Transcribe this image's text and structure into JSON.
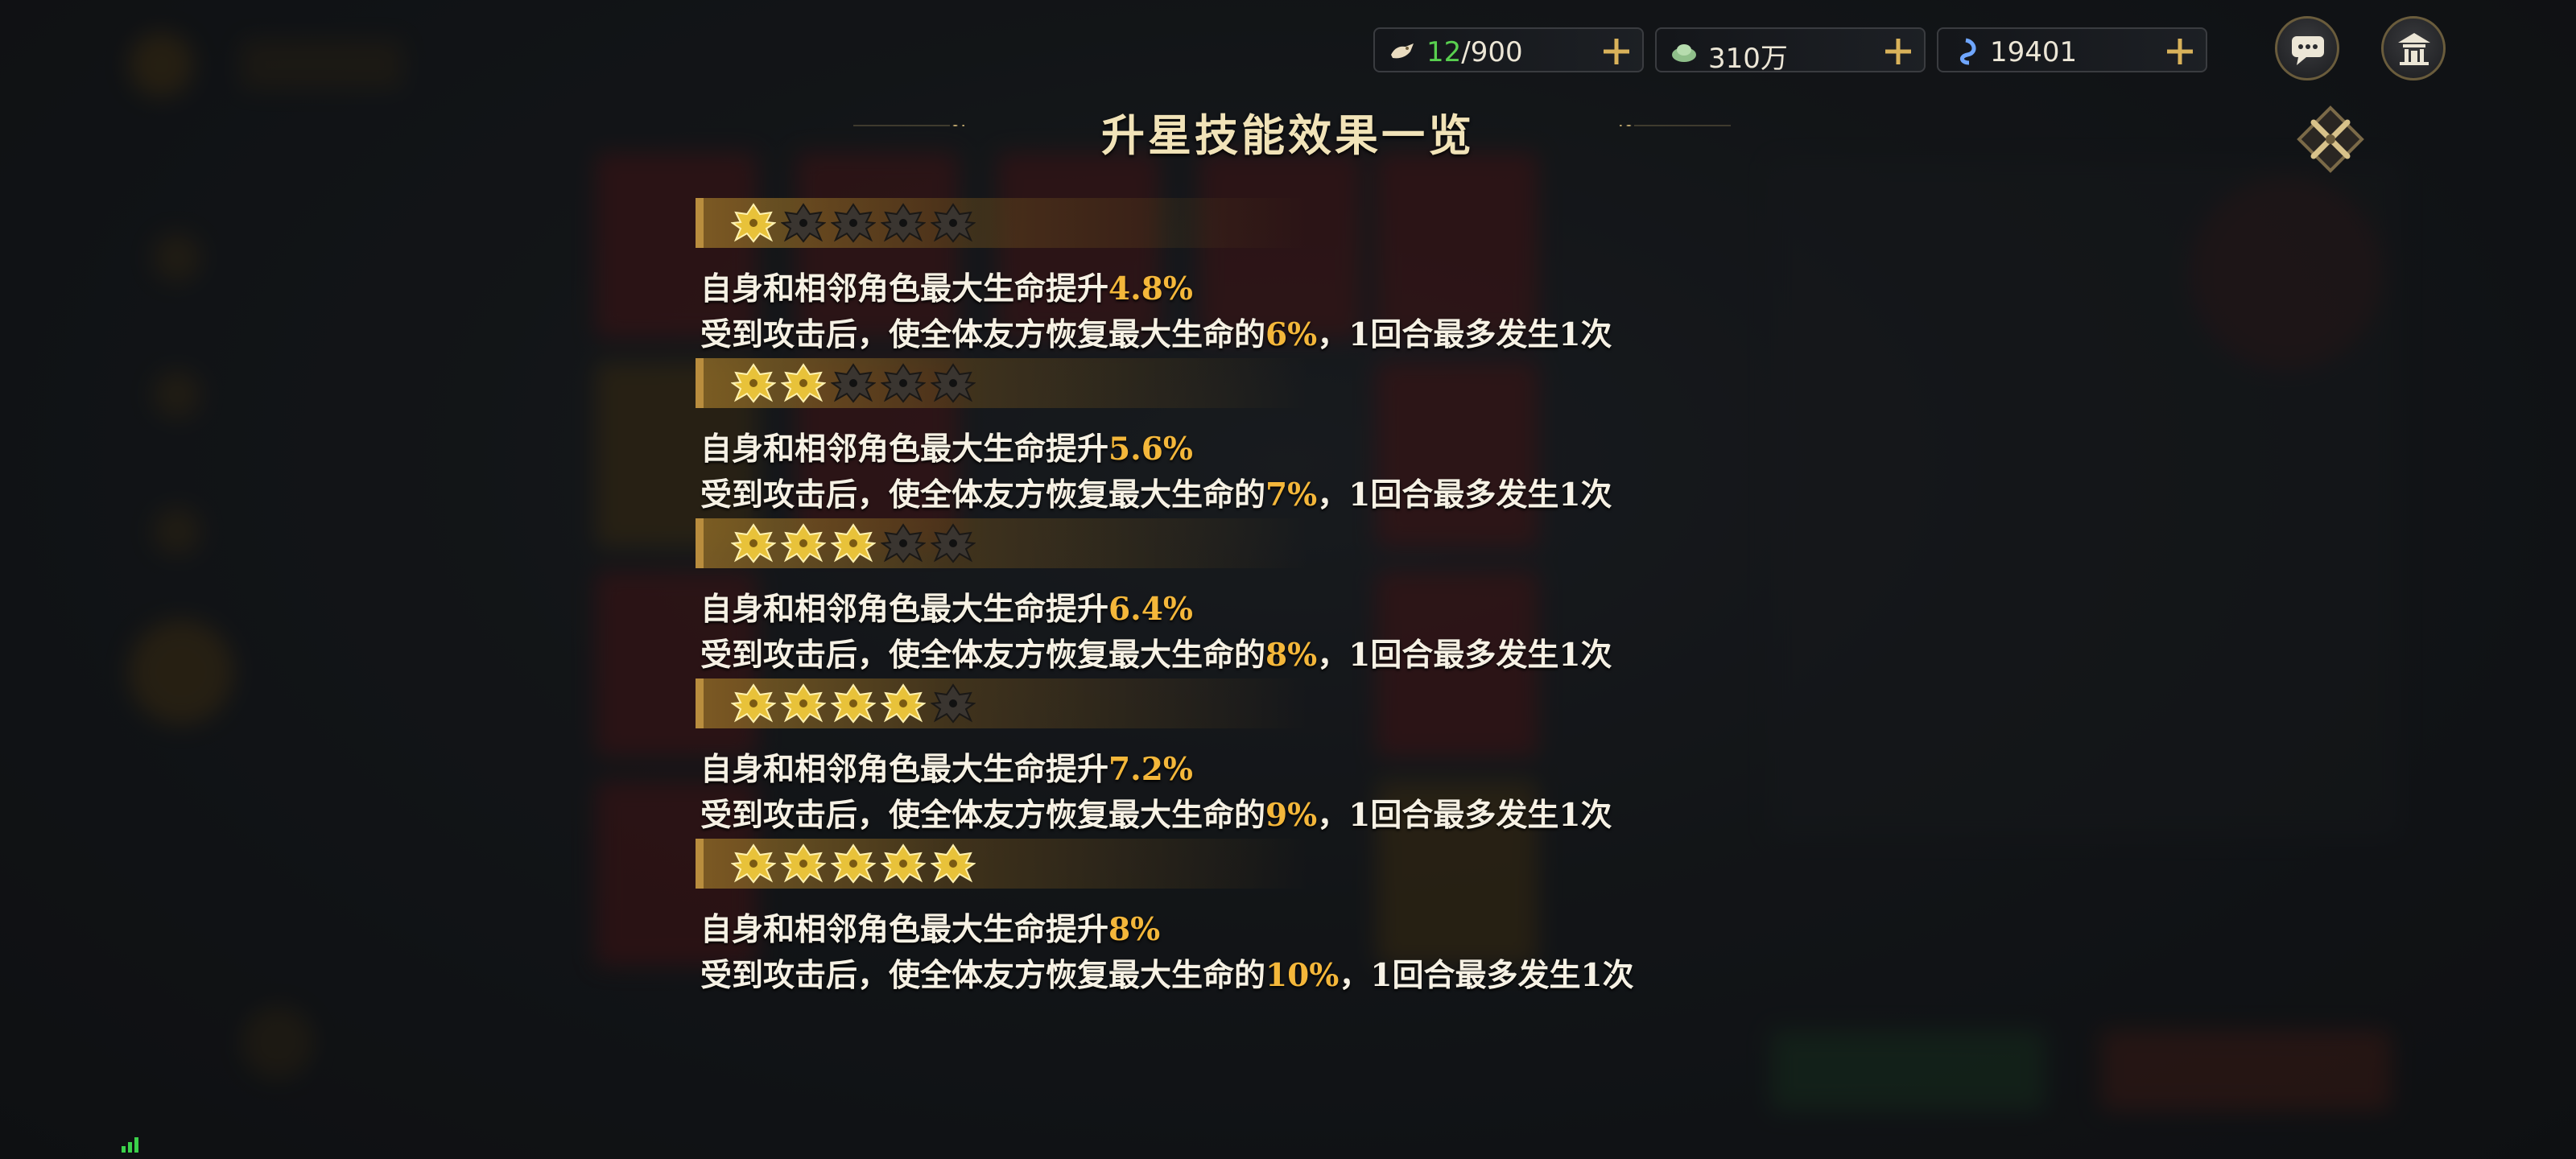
{
  "resources": [
    {
      "icon": "stamina-icon",
      "current": "12",
      "max": "/900"
    },
    {
      "icon": "silver-icon",
      "value": "310万"
    },
    {
      "icon": "jade-icon",
      "value": "19401"
    }
  ],
  "title": "升星技能效果一览",
  "tiers": [
    {
      "stars_filled": 5,
      "stars_total": 5,
      "stars_lit": 1,
      "line1": {
        "prefix": "自身和相邻角色最大生命提升",
        "value": "4.8%"
      },
      "line2": {
        "prefix": "受到攻击后，使全体友方恢复最大生命的",
        "value": "6%",
        "suffix": "，1回合最多发生1次"
      }
    },
    {
      "stars_lit": 2,
      "stars_total": 5,
      "line1": {
        "prefix": "自身和相邻角色最大生命提升",
        "value": "5.6%"
      },
      "line2": {
        "prefix": "受到攻击后，使全体友方恢复最大生命的",
        "value": "7%",
        "suffix": "，1回合最多发生1次"
      }
    },
    {
      "stars_lit": 3,
      "stars_total": 5,
      "line1": {
        "prefix": "自身和相邻角色最大生命提升",
        "value": "6.4%"
      },
      "line2": {
        "prefix": "受到攻击后，使全体友方恢复最大生命的",
        "value": "8%",
        "suffix": "，1回合最多发生1次"
      }
    },
    {
      "stars_lit": 4,
      "stars_total": 5,
      "line1": {
        "prefix": "自身和相邻角色最大生命提升",
        "value": "7.2%"
      },
      "line2": {
        "prefix": "受到攻击后，使全体友方恢复最大生命的",
        "value": "9%",
        "suffix": "，1回合最多发生1次"
      }
    },
    {
      "stars_lit": 5,
      "stars_total": 5,
      "line1": {
        "prefix": "自身和相邻角色最大生命提升",
        "value": "8%"
      },
      "line2": {
        "prefix": "受到攻击后，使全体友方恢复最大生命的",
        "value": "10%",
        "suffix": "，1回合最多发生1次"
      }
    }
  ],
  "colors": {
    "highlight": "#f4b73a",
    "star_lit": "#e8c23a",
    "star_dim": "#3a3530",
    "positive": "#59d04f"
  }
}
